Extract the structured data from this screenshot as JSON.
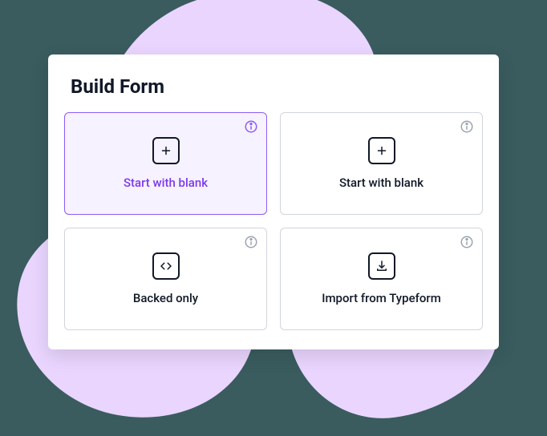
{
  "panel": {
    "title": "Build Form",
    "cards": [
      {
        "label": "Start with blank"
      },
      {
        "label": "Start with blank"
      },
      {
        "label": "Backed only"
      },
      {
        "label": "Import from Typeform"
      }
    ]
  }
}
